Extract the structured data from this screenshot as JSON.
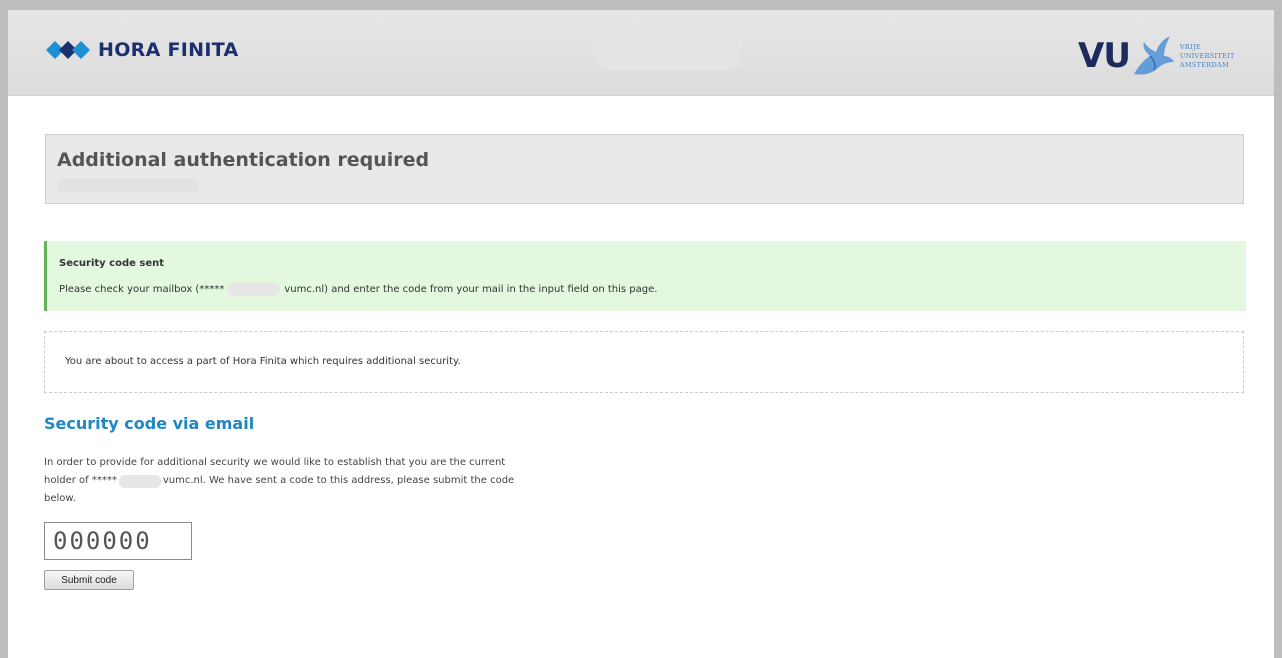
{
  "header": {
    "brand": "HORA FINITA",
    "university": {
      "abbr": "VU",
      "caption_lines": [
        "VRIJE",
        "UNIVERSITEIT",
        "AMSTERDAM"
      ]
    }
  },
  "page": {
    "title": "Additional authentication required"
  },
  "alert": {
    "title": "Security code sent",
    "message_prefix": "Please check your mailbox (*****",
    "message_suffix": "vumc.nl) and enter the code from your mail in the input field on this page."
  },
  "notice": {
    "text": "You are about to access a part of Hora Finita which requires additional security."
  },
  "security": {
    "heading": "Security code via email",
    "paragraph_line1": "In order to provide for additional security we would like to establish that you are the current",
    "paragraph_line2_prefix": "holder of *****",
    "paragraph_line2_suffix": "vumc.nl. We have sent a code to this address, please submit the code",
    "paragraph_line3": "below.",
    "code_placeholder": "000000",
    "submit_label": "Submit code"
  },
  "colors": {
    "brand_navy": "#1c2f6e",
    "brand_blue": "#1e8fd2",
    "alert_bg": "#e3f8df",
    "alert_border": "#63b35a",
    "heading_blue": "#1f87c5"
  }
}
